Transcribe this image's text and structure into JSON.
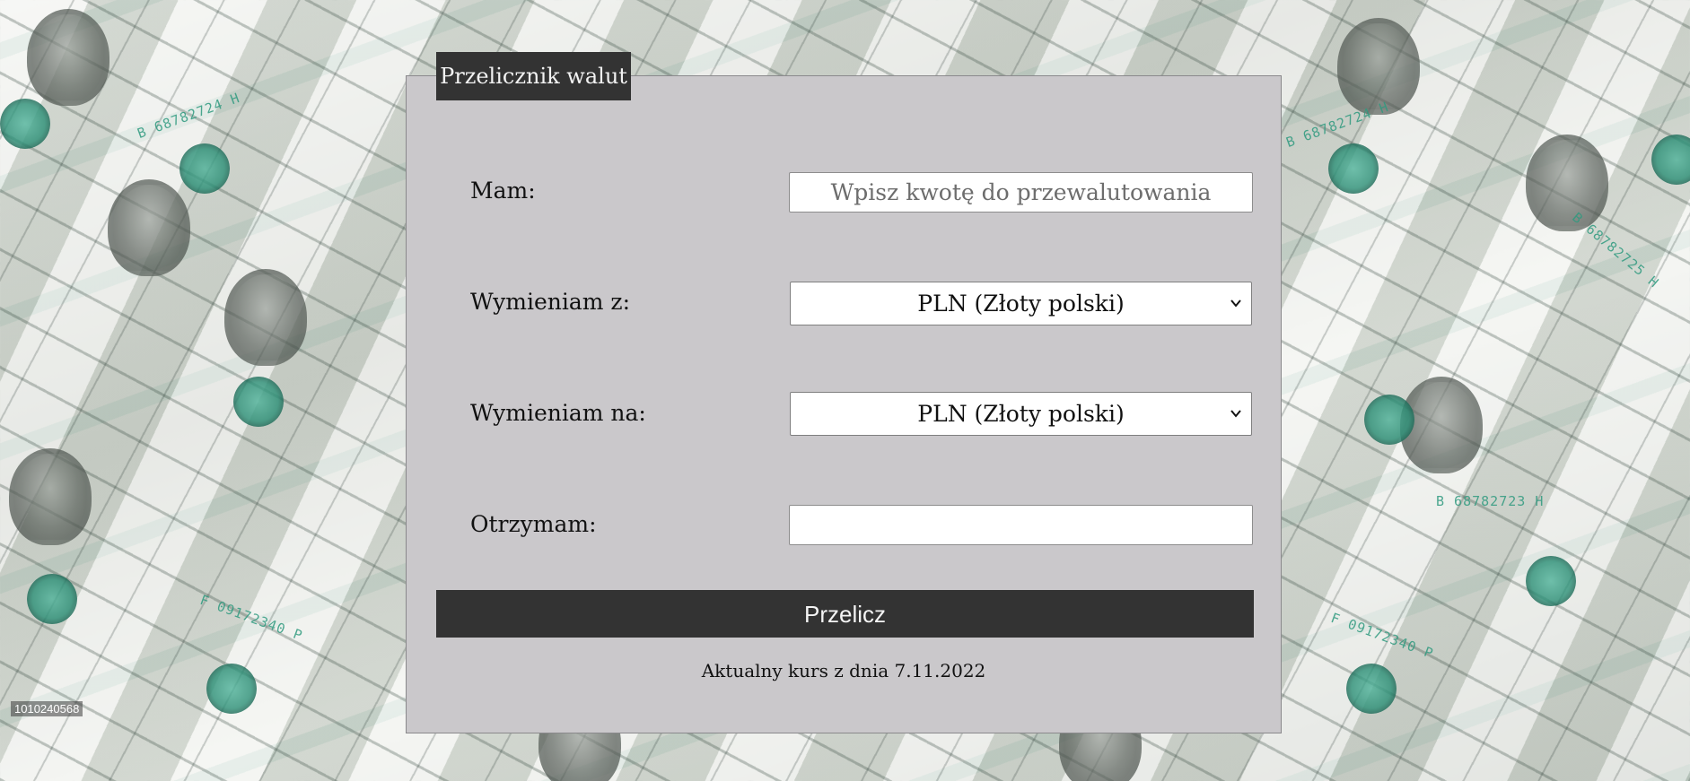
{
  "watermark": "1010240568",
  "converter": {
    "title": "Przelicznik walut",
    "have_label": "Mam:",
    "amount_placeholder": "Wpisz kwotę do przewalutowania",
    "amount_value": "",
    "from_label": "Wymieniam z:",
    "from_selected": "PLN (Złoty polski)",
    "to_label": "Wymieniam na:",
    "to_selected": "PLN (Złoty polski)",
    "receive_label": "Otrzymam:",
    "receive_value": "",
    "convert_button": "Przelicz",
    "rate_note": "Aktualny kurs z dnia 7.11.2022"
  },
  "icons": {
    "select_arrow": "chevron-down-icon"
  },
  "colors": {
    "panel_bg": "#cac8cb",
    "dark": "#333333",
    "background_note_color": "#2f9a7f"
  }
}
